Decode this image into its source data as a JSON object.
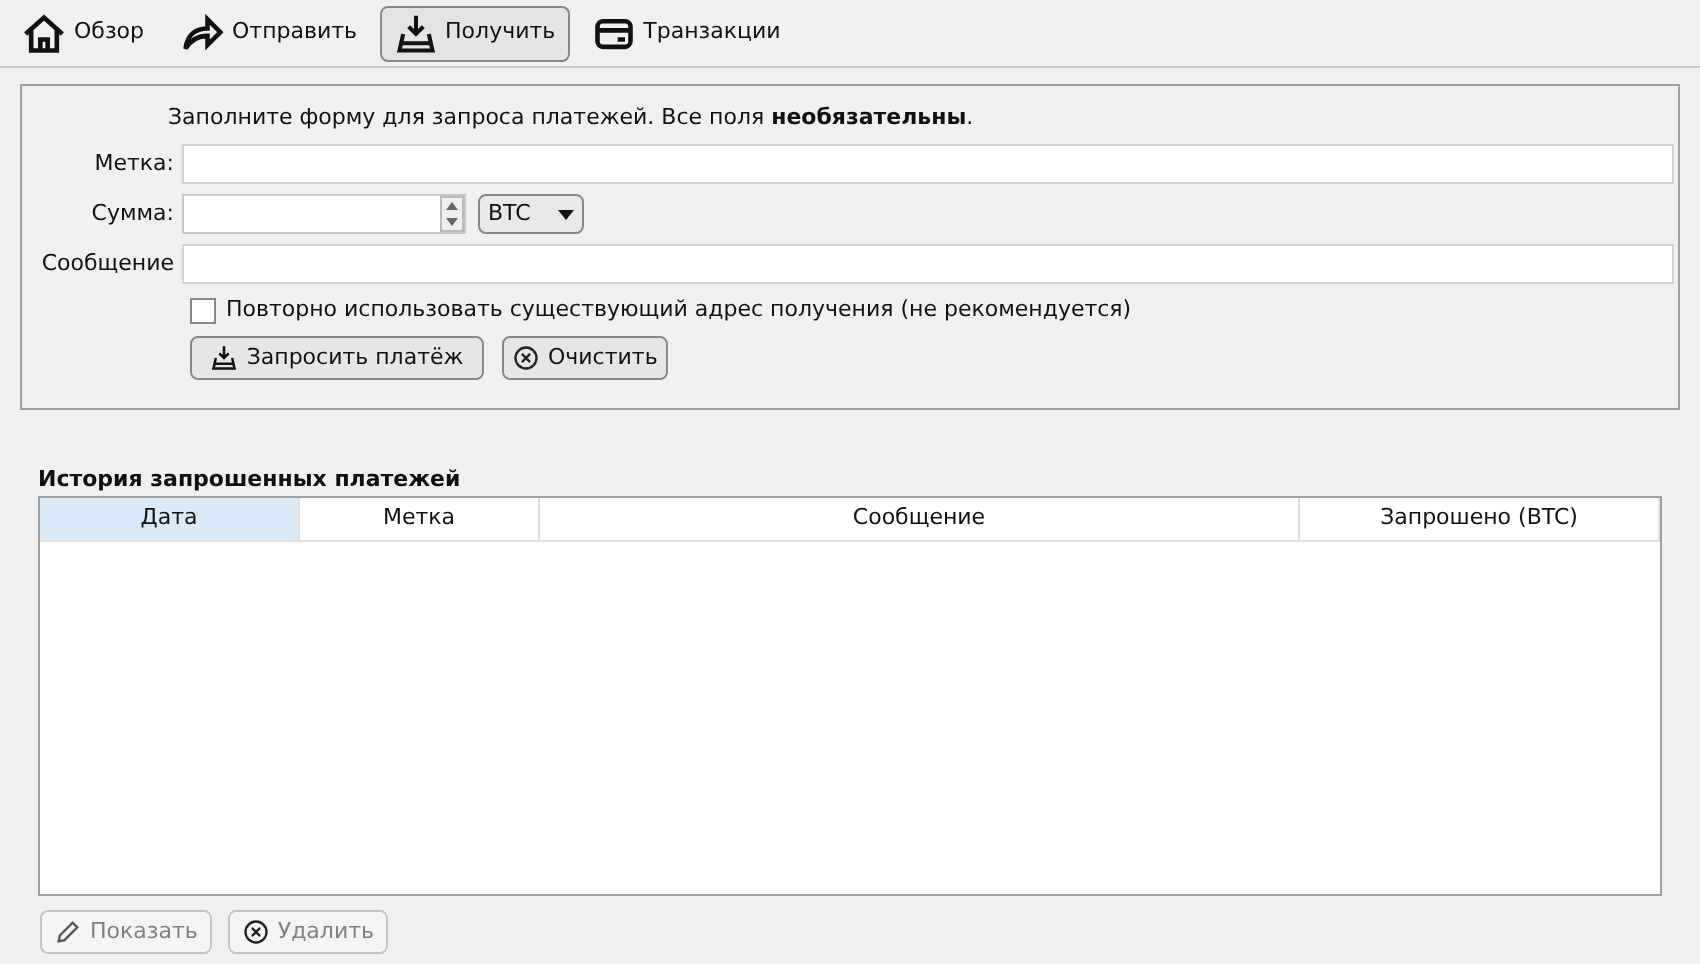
{
  "toolbar": [
    {
      "label": "Обзор",
      "kind": "home",
      "selected": false
    },
    {
      "label": "Отправить",
      "kind": "send",
      "selected": false
    },
    {
      "label": "Получить",
      "kind": "receive",
      "selected": true
    },
    {
      "label": "Транзакции",
      "kind": "card",
      "selected": false
    }
  ],
  "form": {
    "intro": "Заполните форму для запроса платежей. Все поля **необязательны**.",
    "fields": [
      {
        "kind": "text",
        "label": "Метка:"
      },
      {
        "kind": "amount",
        "label": "Сумма:",
        "unit": "BTC"
      },
      {
        "kind": "text",
        "label": "Сообщение"
      }
    ],
    "reuse_address": {
      "label": "Повторно использовать существующий адрес получения (не рекомендуется)",
      "checked": false
    },
    "buttons": [
      {
        "label": "Запросить платёж",
        "kind": "receive"
      },
      {
        "label": "Очистить",
        "kind": "clear"
      }
    ]
  },
  "history": {
    "title": "История запрошенных платежей",
    "columns": [
      {
        "label": "Дата",
        "selected": true
      },
      {
        "label": "Метка",
        "selected": false
      },
      {
        "label": "Сообщение",
        "selected": false
      },
      {
        "label": "Запрошено (BTC)",
        "selected": false
      }
    ],
    "buttons": [
      {
        "label": "Показать",
        "kind": "pencil",
        "disabled": true
      },
      {
        "label": "Удалить",
        "kind": "clear",
        "disabled": true
      }
    ]
  }
}
